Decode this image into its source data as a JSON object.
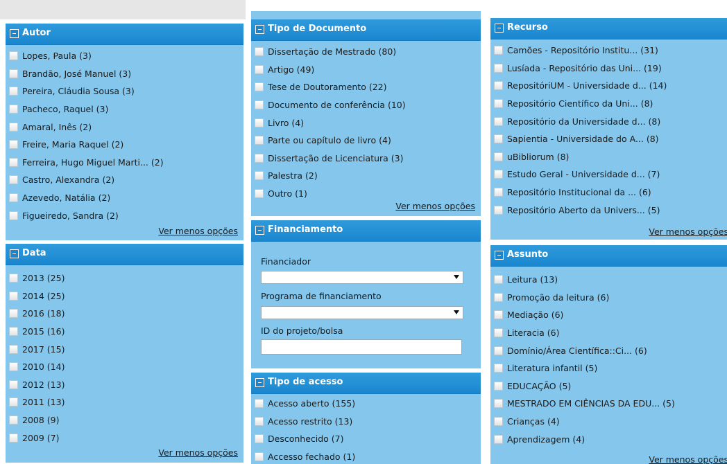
{
  "more_label": "Ver menos opções",
  "autor": {
    "title": "Autor",
    "items": [
      "Lopes, Paula (3)",
      "Brandão, José Manuel (3)",
      "Pereira, Cláudia Sousa (3)",
      "Pacheco, Raquel (3)",
      "Amaral, Inês (2)",
      "Freire, Maria Raquel (2)",
      "Ferreira, Hugo Miguel Marti... (2)",
      "Castro, Alexandra (2)",
      "Azevedo, Natália (2)",
      "Figueiredo, Sandra (2)"
    ]
  },
  "data": {
    "title": "Data",
    "items": [
      "2013 (25)",
      "2014 (25)",
      "2016 (18)",
      "2015 (16)",
      "2017 (15)",
      "2010 (14)",
      "2012 (13)",
      "2011 (13)",
      "2008 (9)",
      "2009 (7)"
    ]
  },
  "tipo_documento": {
    "title": "Tipo de Documento",
    "items": [
      "Dissertação de Mestrado (80)",
      "Artigo (49)",
      "Tese de Doutoramento (22)",
      "Documento de conferência (10)",
      "Livro (4)",
      "Parte ou capítulo de livro (4)",
      "Dissertação de Licenciatura (3)",
      "Palestra (2)",
      "Outro (1)"
    ]
  },
  "financiamento": {
    "title": "Financiamento",
    "financiador_label": "Financiador",
    "financiador_value": "",
    "programa_label": "Programa de financiamento",
    "programa_value": "",
    "projeto_label": "ID do projeto/bolsa",
    "projeto_value": ""
  },
  "tipo_acesso": {
    "title": "Tipo de acesso",
    "items": [
      "Acesso aberto (155)",
      "Acesso restrito (13)",
      "Desconhecido (7)",
      "Accesso fechado (1)"
    ]
  },
  "recurso": {
    "title": "Recurso",
    "items": [
      "Camões - Repositório Institu... (31)",
      "Lusíada - Repositório das Uni... (19)",
      "RepositóriUM - Universidade d... (14)",
      "Repositório Científico da Uni... (8)",
      "Repositório da Universidade d... (8)",
      "Sapientia - Universidade do A... (8)",
      "uBibliorum (8)",
      "Estudo Geral - Universidade d... (7)",
      "Repositório Institucional da ... (6)",
      "Repositório Aberto da Univers... (5)"
    ]
  },
  "assunto": {
    "title": "Assunto",
    "items": [
      "Leitura (13)",
      "Promoção da leitura (6)",
      "Mediação (6)",
      "Literacia (6)",
      "Domínio/Área Científica::Ci... (6)",
      "Literatura infantil (5)",
      "EDUCAÇÃO (5)",
      "MESTRADO EM CIÊNCIAS DA EDU... (5)",
      "Crianças (4)",
      "Aprendizagem (4)"
    ]
  }
}
